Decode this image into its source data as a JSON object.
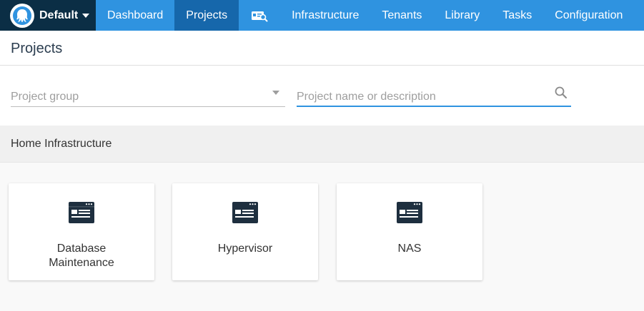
{
  "nav": {
    "space_name": "Default",
    "items": [
      "Dashboard",
      "Projects",
      "Infrastructure",
      "Tenants",
      "Library",
      "Tasks",
      "Configuration"
    ]
  },
  "page": {
    "title": "Projects"
  },
  "filters": {
    "group_placeholder": "Project group",
    "search_placeholder": "Project name or description"
  },
  "group": {
    "title": "Home Infrastructure"
  },
  "projects": [
    {
      "title": "Database Maintenance"
    },
    {
      "title": "Hypervisor"
    },
    {
      "title": "NAS"
    }
  ]
}
